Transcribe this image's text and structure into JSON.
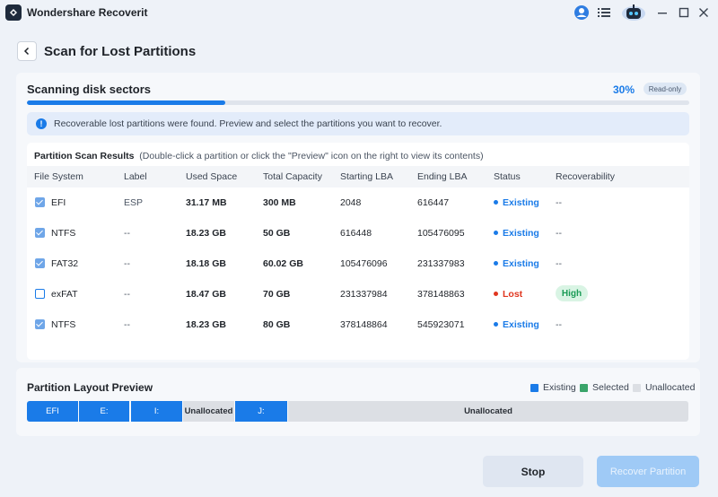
{
  "window": {
    "title": "Wondershare Recoverit",
    "icons": [
      "recoverit-logo-icon",
      "user-icon",
      "list-icon",
      "robot-assistant-icon",
      "minimize-icon",
      "maximize-icon",
      "close-icon"
    ]
  },
  "header": {
    "title": "Scan for Lost Partitions",
    "back_icon": "chevron-left-icon"
  },
  "scan": {
    "title": "Scanning disk sectors",
    "percent_label": "30%",
    "progress": 0.3,
    "readonly_label": "Read-only",
    "info_text": "Recoverable lost partitions were found. Preview and select the partitions you want to recover."
  },
  "results": {
    "title": "Partition Scan Results",
    "hint": "(Double-click a partition or click the \"Preview\" icon on the right to view its contents)",
    "columns": [
      "File System",
      "Label",
      "Used Space",
      "Total Capacity",
      "Starting LBA",
      "Ending LBA",
      "Status",
      "Recoverability"
    ],
    "rows": [
      {
        "checked": true,
        "fs": "EFI",
        "label": "ESP",
        "used": "31.17 MB",
        "total": "300 MB",
        "start": "2048",
        "end": "616447",
        "status": "Existing",
        "recover": "--"
      },
      {
        "checked": true,
        "fs": "NTFS",
        "label": "--",
        "used": "18.23 GB",
        "total": "50 GB",
        "start": "616448",
        "end": "105476095",
        "status": "Existing",
        "recover": "--"
      },
      {
        "checked": true,
        "fs": "FAT32",
        "label": "--",
        "used": "18.18 GB",
        "total": "60.02 GB",
        "start": "105476096",
        "end": "231337983",
        "status": "Existing",
        "recover": "--"
      },
      {
        "checked": false,
        "fs": "exFAT",
        "label": "--",
        "used": "18.47 GB",
        "total": "70 GB",
        "start": "231337984",
        "end": "378148863",
        "status": "Lost",
        "recover": "High"
      },
      {
        "checked": true,
        "fs": "NTFS",
        "label": "--",
        "used": "18.23 GB",
        "total": "80 GB",
        "start": "378148864",
        "end": "545923071",
        "status": "Existing",
        "recover": "--"
      }
    ]
  },
  "layout_preview": {
    "title": "Partition Layout Preview",
    "legend": [
      {
        "label": "Existing",
        "color": "#1a7be8"
      },
      {
        "label": "Selected",
        "color": "#3aa46a"
      },
      {
        "label": "Unallocated",
        "color": "#dcdfe4"
      }
    ],
    "segments": [
      {
        "label": "EFI",
        "kind": "existing"
      },
      {
        "label": "E:",
        "kind": "existing"
      },
      {
        "label": "I:",
        "kind": "existing"
      },
      {
        "label": "Unallocated",
        "kind": "unalloc"
      },
      {
        "label": "J:",
        "kind": "existing"
      },
      {
        "label": "Unallocated",
        "kind": "unalloc"
      }
    ]
  },
  "footer": {
    "stop_label": "Stop",
    "recover_label": "Recover Partition"
  },
  "colors": {
    "accent": "#1a7be8",
    "lost": "#e0361f",
    "high": "#1a9b56"
  }
}
